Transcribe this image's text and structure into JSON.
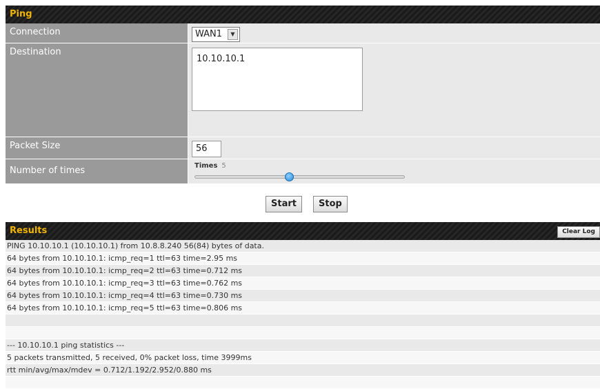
{
  "ping": {
    "title": "Ping",
    "connection_label": "Connection",
    "connection_value": "WAN1",
    "destination_label": "Destination",
    "destination_value": "10.10.10.1",
    "packet_size_label": "Packet Size",
    "packet_size_value": "56",
    "times_row_label": "Number of times",
    "times_slider_label": "Times",
    "times_value": "5",
    "times_level_fraction": 0.45,
    "start_label": "Start",
    "stop_label": "Stop"
  },
  "results": {
    "title": "Results",
    "clear_log_label": "Clear Log",
    "lines": [
      "PING 10.10.10.1 (10.10.10.1) from 10.8.8.240 56(84) bytes of data.",
      "64 bytes from 10.10.10.1: icmp_req=1 ttl=63 time=2.95 ms",
      "64 bytes from 10.10.10.1: icmp_req=2 ttl=63 time=0.712 ms",
      "64 bytes from 10.10.10.1: icmp_req=3 ttl=63 time=0.762 ms",
      "64 bytes from 10.10.10.1: icmp_req=4 ttl=63 time=0.730 ms",
      "64 bytes from 10.10.10.1: icmp_req=5 ttl=63 time=0.806 ms",
      "",
      "",
      "--- 10.10.10.1 ping statistics ---",
      "5 packets transmitted, 5 received, 0% packet loss, time 3999ms",
      "rtt min/avg/max/mdev = 0.712/1.192/2.952/0.880 ms",
      ""
    ]
  },
  "colors": {
    "header_text": "#f0b400",
    "label_bg": "#9a9a9a",
    "value_bg": "#e9e9e9",
    "slider_thumb": "#2a8ad6"
  },
  "icons": {
    "dropdown": "chevron-down-icon"
  }
}
